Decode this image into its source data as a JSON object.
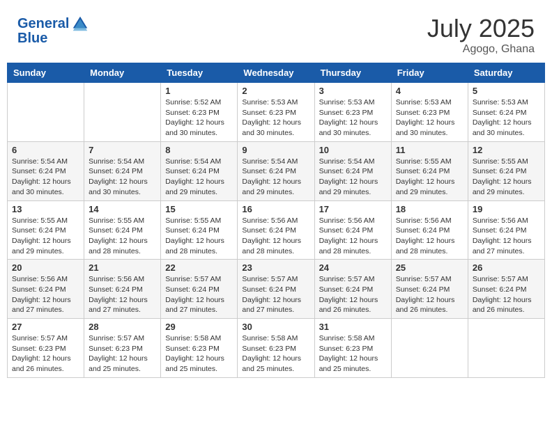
{
  "header": {
    "logo_line1": "General",
    "logo_line2": "Blue",
    "month": "July 2025",
    "location": "Agogo, Ghana"
  },
  "days_of_week": [
    "Sunday",
    "Monday",
    "Tuesday",
    "Wednesday",
    "Thursday",
    "Friday",
    "Saturday"
  ],
  "weeks": [
    [
      {
        "day": "",
        "info": ""
      },
      {
        "day": "",
        "info": ""
      },
      {
        "day": "1",
        "info": "Sunrise: 5:52 AM\nSunset: 6:23 PM\nDaylight: 12 hours and 30 minutes."
      },
      {
        "day": "2",
        "info": "Sunrise: 5:53 AM\nSunset: 6:23 PM\nDaylight: 12 hours and 30 minutes."
      },
      {
        "day": "3",
        "info": "Sunrise: 5:53 AM\nSunset: 6:23 PM\nDaylight: 12 hours and 30 minutes."
      },
      {
        "day": "4",
        "info": "Sunrise: 5:53 AM\nSunset: 6:23 PM\nDaylight: 12 hours and 30 minutes."
      },
      {
        "day": "5",
        "info": "Sunrise: 5:53 AM\nSunset: 6:24 PM\nDaylight: 12 hours and 30 minutes."
      }
    ],
    [
      {
        "day": "6",
        "info": "Sunrise: 5:54 AM\nSunset: 6:24 PM\nDaylight: 12 hours and 30 minutes."
      },
      {
        "day": "7",
        "info": "Sunrise: 5:54 AM\nSunset: 6:24 PM\nDaylight: 12 hours and 30 minutes."
      },
      {
        "day": "8",
        "info": "Sunrise: 5:54 AM\nSunset: 6:24 PM\nDaylight: 12 hours and 29 minutes."
      },
      {
        "day": "9",
        "info": "Sunrise: 5:54 AM\nSunset: 6:24 PM\nDaylight: 12 hours and 29 minutes."
      },
      {
        "day": "10",
        "info": "Sunrise: 5:54 AM\nSunset: 6:24 PM\nDaylight: 12 hours and 29 minutes."
      },
      {
        "day": "11",
        "info": "Sunrise: 5:55 AM\nSunset: 6:24 PM\nDaylight: 12 hours and 29 minutes."
      },
      {
        "day": "12",
        "info": "Sunrise: 5:55 AM\nSunset: 6:24 PM\nDaylight: 12 hours and 29 minutes."
      }
    ],
    [
      {
        "day": "13",
        "info": "Sunrise: 5:55 AM\nSunset: 6:24 PM\nDaylight: 12 hours and 29 minutes."
      },
      {
        "day": "14",
        "info": "Sunrise: 5:55 AM\nSunset: 6:24 PM\nDaylight: 12 hours and 28 minutes."
      },
      {
        "day": "15",
        "info": "Sunrise: 5:55 AM\nSunset: 6:24 PM\nDaylight: 12 hours and 28 minutes."
      },
      {
        "day": "16",
        "info": "Sunrise: 5:56 AM\nSunset: 6:24 PM\nDaylight: 12 hours and 28 minutes."
      },
      {
        "day": "17",
        "info": "Sunrise: 5:56 AM\nSunset: 6:24 PM\nDaylight: 12 hours and 28 minutes."
      },
      {
        "day": "18",
        "info": "Sunrise: 5:56 AM\nSunset: 6:24 PM\nDaylight: 12 hours and 28 minutes."
      },
      {
        "day": "19",
        "info": "Sunrise: 5:56 AM\nSunset: 6:24 PM\nDaylight: 12 hours and 27 minutes."
      }
    ],
    [
      {
        "day": "20",
        "info": "Sunrise: 5:56 AM\nSunset: 6:24 PM\nDaylight: 12 hours and 27 minutes."
      },
      {
        "day": "21",
        "info": "Sunrise: 5:56 AM\nSunset: 6:24 PM\nDaylight: 12 hours and 27 minutes."
      },
      {
        "day": "22",
        "info": "Sunrise: 5:57 AM\nSunset: 6:24 PM\nDaylight: 12 hours and 27 minutes."
      },
      {
        "day": "23",
        "info": "Sunrise: 5:57 AM\nSunset: 6:24 PM\nDaylight: 12 hours and 27 minutes."
      },
      {
        "day": "24",
        "info": "Sunrise: 5:57 AM\nSunset: 6:24 PM\nDaylight: 12 hours and 26 minutes."
      },
      {
        "day": "25",
        "info": "Sunrise: 5:57 AM\nSunset: 6:24 PM\nDaylight: 12 hours and 26 minutes."
      },
      {
        "day": "26",
        "info": "Sunrise: 5:57 AM\nSunset: 6:24 PM\nDaylight: 12 hours and 26 minutes."
      }
    ],
    [
      {
        "day": "27",
        "info": "Sunrise: 5:57 AM\nSunset: 6:23 PM\nDaylight: 12 hours and 26 minutes."
      },
      {
        "day": "28",
        "info": "Sunrise: 5:57 AM\nSunset: 6:23 PM\nDaylight: 12 hours and 25 minutes."
      },
      {
        "day": "29",
        "info": "Sunrise: 5:58 AM\nSunset: 6:23 PM\nDaylight: 12 hours and 25 minutes."
      },
      {
        "day": "30",
        "info": "Sunrise: 5:58 AM\nSunset: 6:23 PM\nDaylight: 12 hours and 25 minutes."
      },
      {
        "day": "31",
        "info": "Sunrise: 5:58 AM\nSunset: 6:23 PM\nDaylight: 12 hours and 25 minutes."
      },
      {
        "day": "",
        "info": ""
      },
      {
        "day": "",
        "info": ""
      }
    ]
  ]
}
